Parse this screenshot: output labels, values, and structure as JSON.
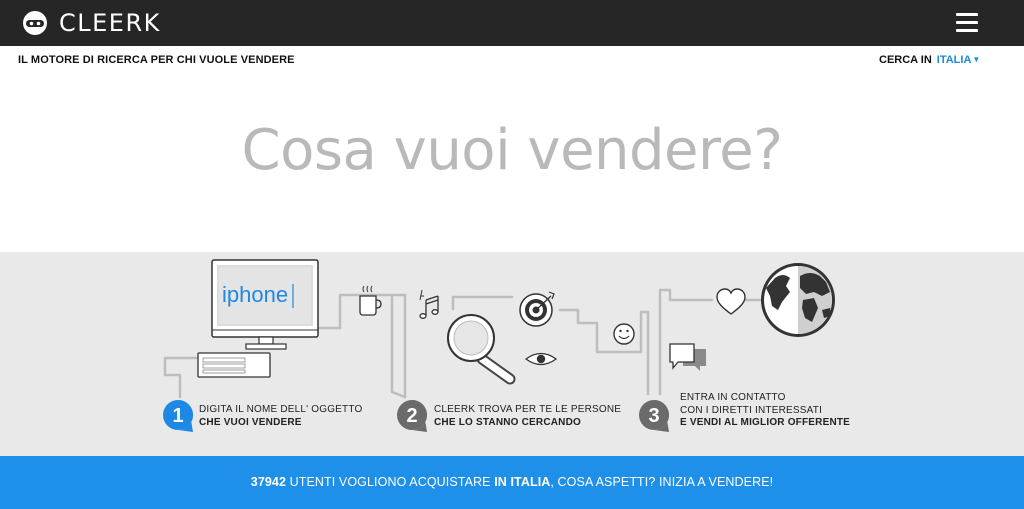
{
  "header": {
    "brand": "CLEERK",
    "icons": {
      "logo": "robot-face-icon",
      "menu": "hamburger-menu-icon"
    }
  },
  "subheader": {
    "tagline": "IL MOTORE DI RICERCA PER CHI VUOLE VENDERE",
    "search_in_label": "CERCA IN",
    "country": "ITALIA",
    "caret": "▼"
  },
  "search": {
    "placeholder": "Cosa vuoi vendere?"
  },
  "illustration": {
    "screen_text": "iphone",
    "icons": [
      "computer-monitor-icon",
      "keyboard-icon",
      "coffee-cup-icon",
      "music-note-icon",
      "magnifying-glass-icon",
      "target-icon",
      "eye-icon",
      "smiley-icon",
      "chat-bubbles-icon",
      "heart-icon",
      "globe-icon"
    ]
  },
  "steps": [
    {
      "number": "1",
      "line1": "DIGITA IL NOME DELL' OGGETTO",
      "line2": "CHE VUOI VENDERE",
      "line3": ""
    },
    {
      "number": "2",
      "line1": "CLEERK TROVA PER TE LE PERSONE",
      "line2": "CHE LO STANNO CERCANDO",
      "line3": ""
    },
    {
      "number": "3",
      "line1": "ENTRA IN CONTATTO",
      "line2": "CON I DIRETTI INTERESSATI",
      "line3": "E VENDI AL MIGLIOR OFFERENTE"
    }
  ],
  "cta": {
    "count": "37942",
    "text_a": " UTENTI VOGLIONO ACQUISTARE ",
    "location": "IN ITALIA",
    "text_b": ", COSA ASPETTI? INIZIA A VENDERE!"
  },
  "colors": {
    "topbar": "#262626",
    "accent": "#1e90ea",
    "band": "#e9e9e9",
    "step_badge_active": "#1e88e5",
    "step_badge_inactive": "#6b6b6b"
  }
}
